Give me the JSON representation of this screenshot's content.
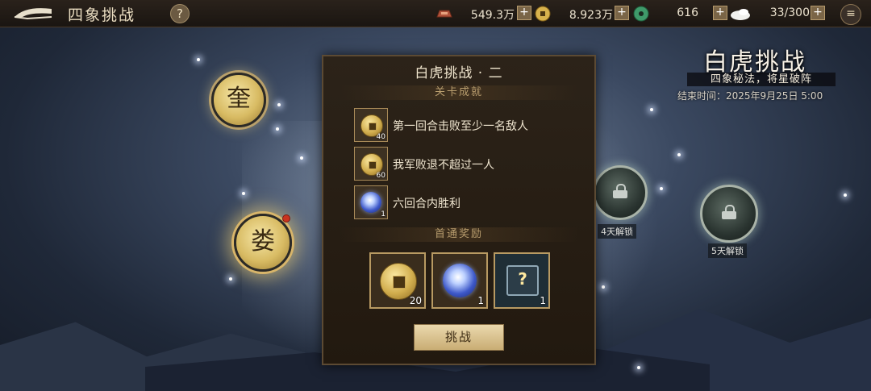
{
  "header": {
    "title": "四象挑战",
    "help_label": "?",
    "resources": [
      {
        "icon": "copper-ingot-icon",
        "value": "549.3万"
      },
      {
        "icon": "gold-coin-icon",
        "value": "8.923万"
      },
      {
        "icon": "jade-icon",
        "value": "616"
      },
      {
        "icon": "rice-icon",
        "value": "33/300"
      }
    ],
    "plus_label": "+",
    "menu_icon": "menu-icon"
  },
  "constellations": {
    "kui": "奎",
    "lou": "娄"
  },
  "locked_nodes": [
    {
      "label": "4天解锁"
    },
    {
      "label": "5天解锁"
    }
  ],
  "event": {
    "title": "白虎挑战",
    "subtitle": "四象秘法，将星破阵",
    "end_time": "结束时间：2025年9月25日 5:00"
  },
  "dialog": {
    "title": "白虎挑战 · 二",
    "achievements_header": "关卡成就",
    "achievements": [
      {
        "icon": "gold-coin-icon",
        "qty": "40",
        "text": "第一回合击败至少一名敌人"
      },
      {
        "icon": "gold-coin-icon",
        "qty": "60",
        "text": "我军败退不超过一人"
      },
      {
        "icon": "star-orb-icon",
        "qty": "1",
        "text": "六回合内胜利"
      }
    ],
    "rewards_header": "首通奖励",
    "rewards": [
      {
        "icon": "gold-coin-icon",
        "qty": "20"
      },
      {
        "icon": "star-orb-icon",
        "qty": "1"
      },
      {
        "icon": "mystery-chest-icon",
        "qty": "1"
      }
    ],
    "chest_mark": "?",
    "challenge_label": "挑战"
  }
}
